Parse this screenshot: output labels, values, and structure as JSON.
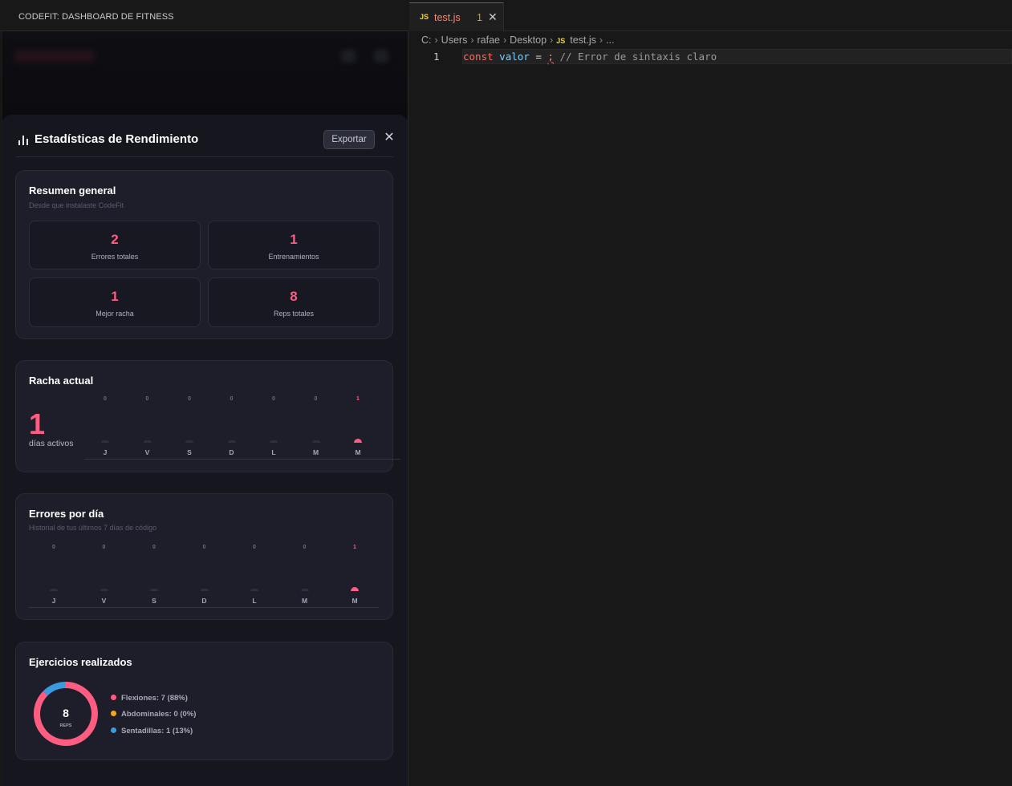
{
  "webview": {
    "title": "CODEFIT: DASHBOARD DE FITNESS"
  },
  "stats_panel": {
    "title": "Estadísticas de Rendimiento",
    "export_label": "Exportar",
    "close_glyph": "✕",
    "summary": {
      "title": "Resumen general",
      "subtitle": "Desde que instalaste CodeFit",
      "items": [
        {
          "value": "2",
          "label": "Errores totales"
        },
        {
          "value": "1",
          "label": "Entrenamientos"
        },
        {
          "value": "1",
          "label": "Mejor racha"
        },
        {
          "value": "8",
          "label": "Reps totales"
        }
      ]
    },
    "streak": {
      "title": "Racha actual",
      "value": "1",
      "label": "días activos"
    },
    "errors_per_day": {
      "title": "Errores por día",
      "subtitle": "Historial de tus últimos 7 días de código"
    },
    "exercises": {
      "title": "Ejercicios realizados",
      "total": "8",
      "total_label": "REPS",
      "legend": [
        {
          "label": "Flexiones: 7 (88%)",
          "color": "#ff5c82"
        },
        {
          "label": "Abdominales: 0 (0%)",
          "color": "#f5a623"
        },
        {
          "label": "Sentadillas: 1 (13%)",
          "color": "#3b9be0"
        }
      ]
    }
  },
  "chart_data": [
    {
      "type": "bar",
      "categories": [
        "J",
        "V",
        "S",
        "D",
        "L",
        "M",
        "M"
      ],
      "values": [
        0,
        0,
        0,
        0,
        0,
        0,
        1
      ],
      "title": "Racha actual"
    },
    {
      "type": "bar",
      "categories": [
        "J",
        "V",
        "S",
        "D",
        "L",
        "M",
        "M"
      ],
      "values": [
        0,
        0,
        0,
        0,
        0,
        0,
        1
      ],
      "title": "Errores por día"
    },
    {
      "type": "pie",
      "categories": [
        "Flexiones",
        "Abdominales",
        "Sentadillas"
      ],
      "values": [
        7,
        0,
        1
      ],
      "colors": [
        "#ff5c82",
        "#f5a623",
        "#3b9be0"
      ],
      "title": "Ejercicios realizados"
    }
  ],
  "editor": {
    "tab": {
      "badge": "JS",
      "name": "test.js",
      "problems": "1",
      "close_glyph": "✕"
    },
    "breadcrumb": [
      "C:",
      "Users",
      "rafae",
      "Desktop",
      "test.js",
      "..."
    ],
    "breadcrumb_file_badge": "JS",
    "line_number": "1",
    "code": {
      "keyword": "const",
      "variable": "valor",
      "operator": " = ",
      "error_token": ";",
      "comment": " // Error de sintaxis claro"
    }
  }
}
